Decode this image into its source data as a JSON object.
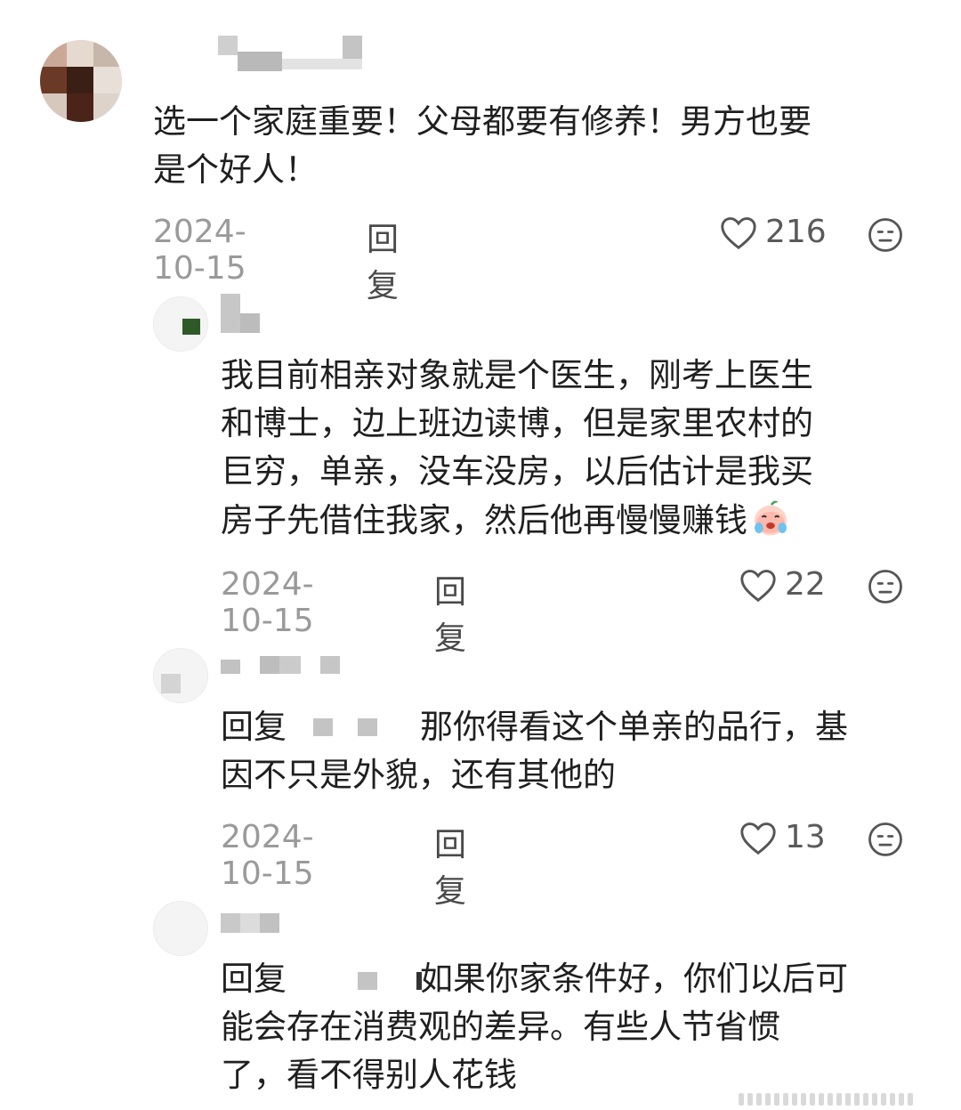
{
  "comments": [
    {
      "text": "选一个家庭重要！父母都要有修养！男方也要\n是个好人！",
      "date": "2024-10-15",
      "reply_label": "回复",
      "likes": "216"
    },
    {
      "text": "我目前相亲对象就是个医生，刚考上医生\n和博士，边上班边读博，但是家里农村的\n巨穷，单亲，没车没房，以后估计是我买\n房子先借住我家，然后他再慢慢赚钱",
      "date": "2024-10-15",
      "reply_label": "回复",
      "likes": "22"
    },
    {
      "prefix": "回复",
      "text_line1": "那你得看这个单亲的品行，基",
      "text_line2": "因不只是外貌，还有其他的",
      "date": "2024-10-15",
      "reply_label": "回复",
      "likes": "13"
    },
    {
      "prefix": "回复",
      "text_line1": "如果你家条件好，你们以后可",
      "text_line2": "能会存在消费观的差异。有些人节省惯",
      "text_line3": "了，看不得别人花钱"
    }
  ],
  "icons": {
    "like": "heart-outline-icon",
    "more": "meh-face-icon",
    "emoji": "crying-laugh-emoji"
  },
  "colors": {
    "text": "#1f1f1f",
    "meta": "#9a9a9a",
    "reply": "#4a4a4a"
  }
}
